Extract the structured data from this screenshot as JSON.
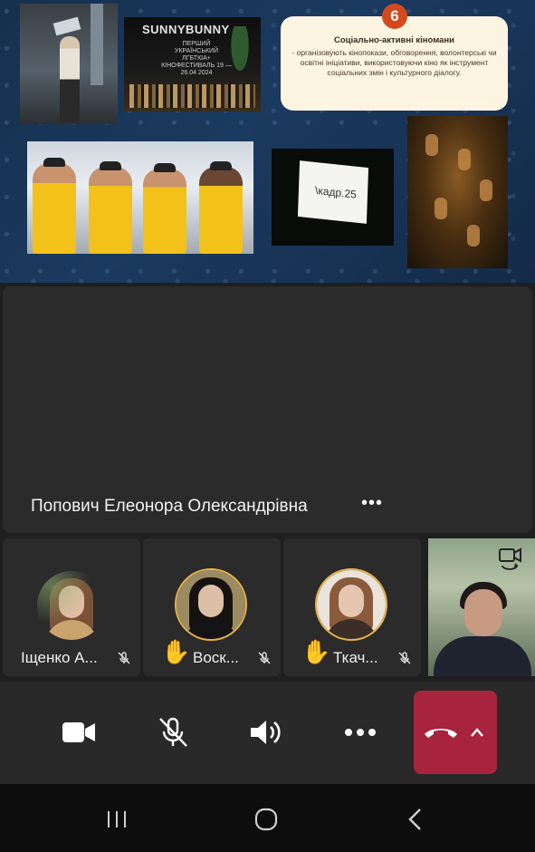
{
  "slide": {
    "badge_number": "6",
    "card_title": "Соціально-активні кіномани",
    "card_body": "- організовують кінопокази, обговорення, волонтерські чи освітні ініціативи, використовуючи кіно як інструмент соціальних змін і культурного діалогу.",
    "fest_logo": "SUNNYBUNNY",
    "fest_subtitle": "ПЕРШИЙ УКРАЇНСЬКИЙ ЛГБТКІА+ КІНОФЕСТИВАЛЬ 19 — 26.04 2024",
    "screen_text": "\\кадр.25"
  },
  "speaker": {
    "name": "Попович Елеонора Олександрівна"
  },
  "participants": [
    {
      "name": "Іщенко А...",
      "hand_raised": false,
      "muted": true
    },
    {
      "name": "Воск...",
      "hand_raised": true,
      "muted": true
    },
    {
      "name": "Ткач...",
      "hand_raised": true,
      "muted": true
    }
  ],
  "controls": {
    "camera": "camera-icon",
    "mic": "mic-off-icon",
    "speaker": "speaker-icon",
    "more": "more-icon",
    "end_call": "hang-up-icon"
  },
  "colors": {
    "end_call": "#a8243e",
    "badge": "#d44a1e",
    "hand_ring": "#e8b24a"
  }
}
